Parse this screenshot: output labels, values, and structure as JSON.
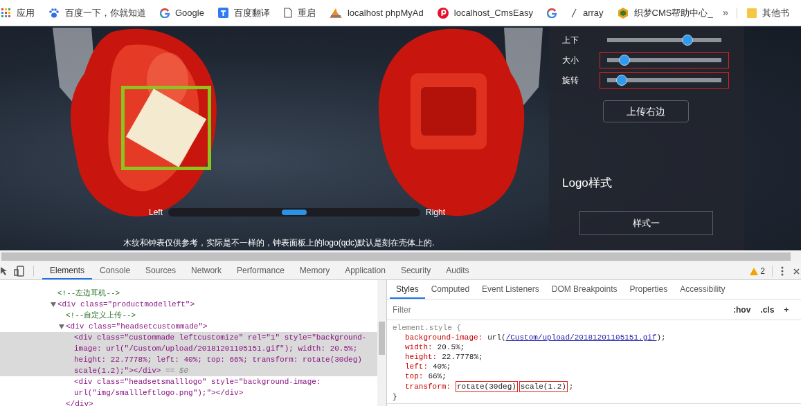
{
  "bookmarks": [
    {
      "kind": "apps",
      "label": "应用"
    },
    {
      "kind": "paw",
      "label": "百度一下，你就知道"
    },
    {
      "kind": "google",
      "label": "Google"
    },
    {
      "kind": "translate",
      "label": "百度翻译"
    },
    {
      "kind": "page",
      "label": "重启"
    },
    {
      "kind": "pma",
      "label": "localhost phpMyAd"
    },
    {
      "kind": "pcircle",
      "label": "localhost_CmsEasy"
    },
    {
      "kind": "google"
    },
    {
      "kind": "slash",
      "label": "array"
    },
    {
      "kind": "hexagon",
      "label": "织梦CMS帮助中心_"
    }
  ],
  "bookmarks_overflow": "»",
  "other_bookmarks": {
    "kind": "folder",
    "label": "其他书"
  },
  "controls": [
    {
      "label": "上下",
      "level": 0.7,
      "highlighted": false
    },
    {
      "label": "大小",
      "level": 0.15,
      "highlighted": true
    },
    {
      "label": "旋转",
      "level": 0.13,
      "highlighted": true
    }
  ],
  "upload_button": "上传右边",
  "logo_heading": "Logo样式",
  "style_button": "样式一",
  "position_slider": {
    "left_label": "Left",
    "right_label": "Right",
    "level": 0.5
  },
  "caption": "木纹和钟表仅供参考，实际是不一样的，钟表面板上的logo(qdc)默认是刻在壳体上的.",
  "devtools": {
    "tabs": [
      {
        "label": "Elements",
        "selected": true
      },
      {
        "label": "Console",
        "selected": false
      },
      {
        "label": "Sources",
        "selected": false
      },
      {
        "label": "Network",
        "selected": false
      },
      {
        "label": "Performance",
        "selected": false
      },
      {
        "label": "Memory",
        "selected": false
      },
      {
        "label": "Application",
        "selected": false
      },
      {
        "label": "Security",
        "selected": false
      },
      {
        "label": "Audits",
        "selected": false
      }
    ],
    "warning_count": "2",
    "dom_tree": [
      {
        "kind": "comment",
        "text": "<!--左边耳机-->",
        "selected": false
      },
      {
        "kind": "element",
        "text": "<div class=\"productmodelleft\">",
        "expanded": true,
        "selected": false,
        "children": [
          {
            "kind": "comment",
            "text": "<!--自定义上传-->",
            "selected": false
          },
          {
            "kind": "element",
            "text": "<div class=\"headsetcustommade\">",
            "expanded": true,
            "selected": false,
            "closing": "</div>",
            "children": [
              {
                "kind": "element",
                "text": "<div class=\"custommade leftcustomize\" rel=\"1\" style=\"background-image: url(\"/Custom/upload/20181201105151.gif\"); width: 20.5%; height: 22.7778%; left: 40%; top: 66%; transform: rotate(30deg) scale(1.2);\"></div>",
                "selected": true,
                "console_ref": "== $0"
              },
              {
                "kind": "element",
                "text": "<div class=\"headsetsmalllogo\" style=\"background-image: url(\"img/smallleftlogo.png\");\"></div>",
                "selected": false
              }
            ]
          }
        ]
      }
    ],
    "style_tabs": [
      {
        "label": "Styles",
        "selected": true
      },
      {
        "label": "Computed",
        "selected": false
      },
      {
        "label": "Event Listeners",
        "selected": false
      },
      {
        "label": "DOM Breakpoints",
        "selected": false
      },
      {
        "label": "Properties",
        "selected": false
      },
      {
        "label": "Accessibility",
        "selected": false
      }
    ],
    "filter": {
      "placeholder": "Filter"
    },
    "filter_toggles": [
      ":hov",
      ".cls",
      "+"
    ],
    "rule": {
      "selector": "element.style {",
      "declarations": [
        {
          "property": "background-image:",
          "parts": [
            {
              "kind": "plain",
              "text": "url("
            },
            {
              "kind": "link",
              "text": "/Custom/upload/20181201105151.gif"
            },
            {
              "kind": "plain",
              "text": ");"
            }
          ]
        },
        {
          "property": "width:",
          "parts": [
            {
              "kind": "plain",
              "text": "20.5%;"
            }
          ]
        },
        {
          "property": "height:",
          "parts": [
            {
              "kind": "plain",
              "text": "22.7778%;"
            }
          ]
        },
        {
          "property": "left:",
          "parts": [
            {
              "kind": "plain",
              "text": "40%;"
            }
          ]
        },
        {
          "property": "top:",
          "parts": [
            {
              "kind": "plain",
              "text": "66%;"
            }
          ]
        },
        {
          "property": "transform:",
          "parts": [
            {
              "kind": "boxed",
              "text": "rotate(30deg)"
            },
            {
              "kind": "boxed",
              "text": "scale(1.2)"
            },
            {
              "kind": "plain",
              "text": ";"
            }
          ]
        }
      ],
      "closing": "}"
    }
  }
}
